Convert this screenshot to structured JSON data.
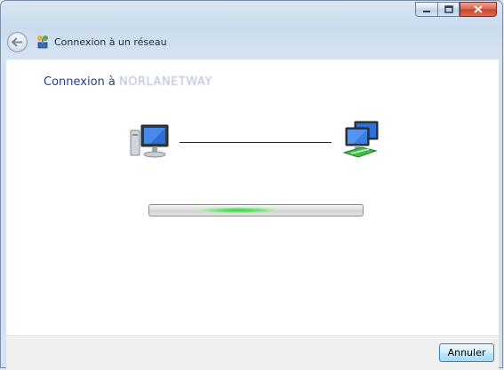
{
  "window": {
    "title": "Connexion à un réseau",
    "caption_buttons": [
      "minimize-icon",
      "maximize-icon",
      "close-icon"
    ]
  },
  "nav": {
    "back_icon": "back-arrow-icon",
    "wizard_icon": "network-connect-icon"
  },
  "content": {
    "heading_prefix": "Connexion à",
    "heading_network": "NORLANETWAY",
    "local_computer_icon": "computer-icon",
    "network_icon": "network-computers-icon",
    "progress": {
      "state": "indeterminate",
      "color": "#37d43c"
    }
  },
  "footer": {
    "cancel_label": "Annuler"
  }
}
